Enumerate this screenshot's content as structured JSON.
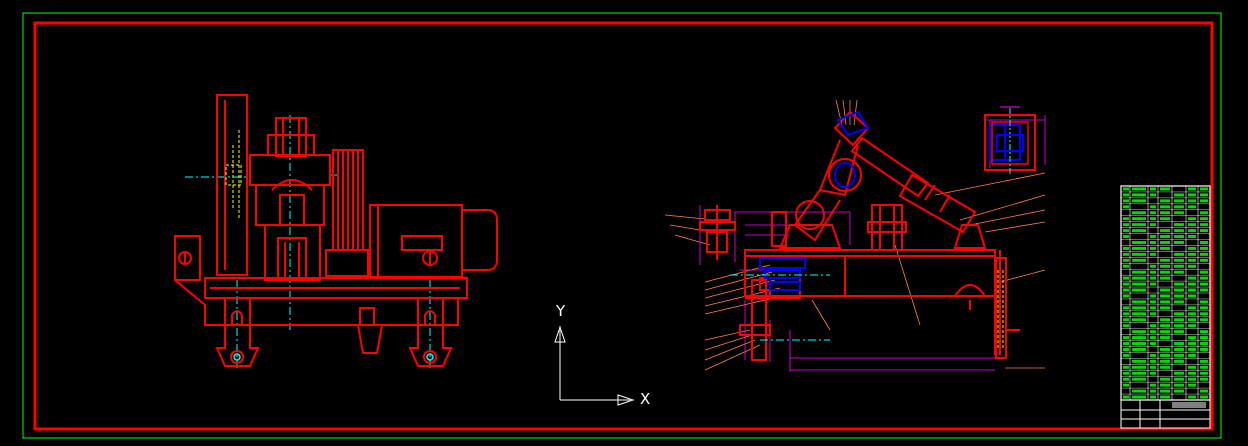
{
  "drawing": {
    "background": "#000000",
    "colors": {
      "outer_frame": "#00ff00",
      "inner_frame": "#ff0000",
      "geometry": "#ff0000",
      "centerline": "#00ffff",
      "hidden": "#ffff00",
      "dimension": "#ff00ff",
      "leader": "#ff7f50",
      "hatch": "#0000ff",
      "title_block": "#ffffff",
      "table_text": "#00ff00"
    },
    "ucs_icon": {
      "x_label": "X",
      "y_label": "Y"
    },
    "views": [
      "front-view",
      "side-view",
      "section-a-a-detail"
    ],
    "bom_rows": 36
  }
}
